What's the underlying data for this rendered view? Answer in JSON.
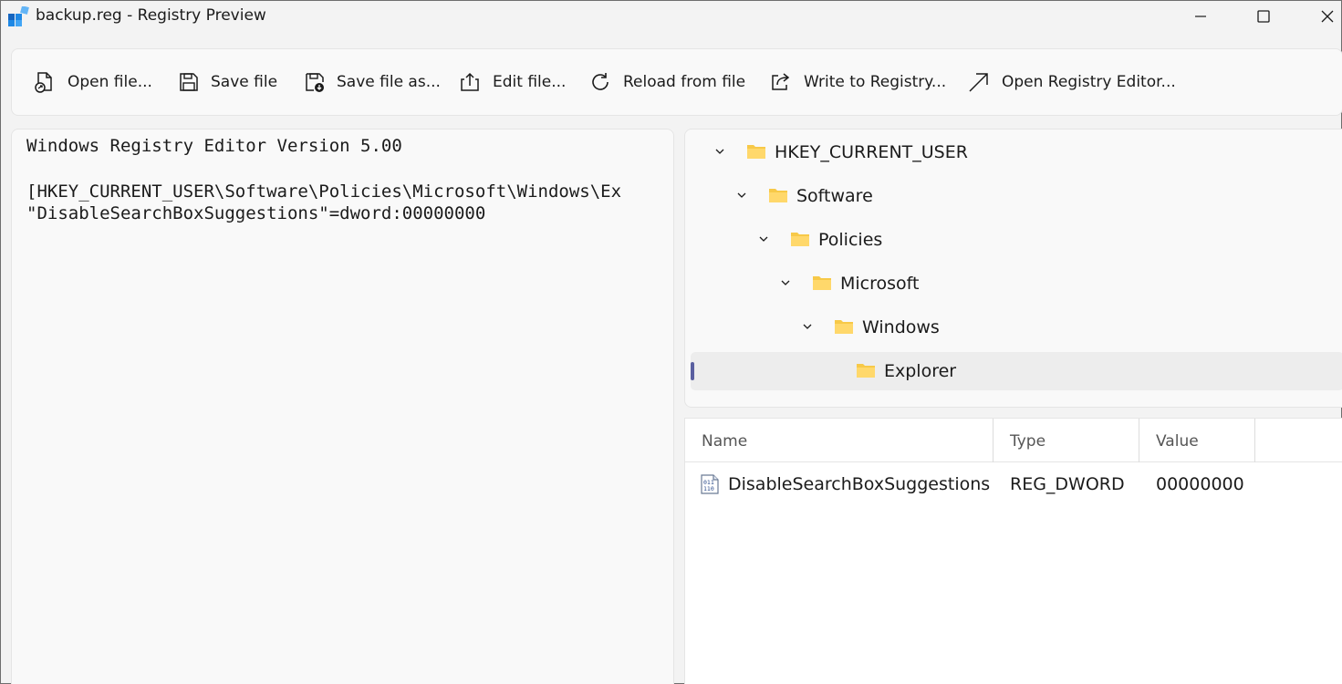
{
  "window": {
    "title": "backup.reg - Registry Preview",
    "icon": "registry-preview-app-icon",
    "controls": [
      "minimize-icon",
      "maximize-icon",
      "close-icon"
    ]
  },
  "toolbar": {
    "open_file": "Open file...",
    "save_file": "Save file",
    "save_file_as": "Save file as...",
    "edit_file": "Edit file...",
    "reload_from_file": "Reload from file",
    "write_to_registry": "Write to Registry...",
    "open_registry_editor": "Open Registry Editor..."
  },
  "editor": {
    "lines": [
      "Windows Registry Editor Version 5.00",
      "",
      "[HKEY_CURRENT_USER\\Software\\Policies\\Microsoft\\Windows\\Ex",
      "\"DisableSearchBoxSuggestions\"=dword:00000000"
    ]
  },
  "tree": {
    "items": [
      {
        "label": "HKEY_CURRENT_USER",
        "expanded": true
      },
      {
        "label": "Software",
        "expanded": true
      },
      {
        "label": "Policies",
        "expanded": true
      },
      {
        "label": "Microsoft",
        "expanded": true
      },
      {
        "label": "Windows",
        "expanded": true
      },
      {
        "label": "Explorer",
        "selected": true
      }
    ]
  },
  "values_table": {
    "columns": [
      "Name",
      "Type",
      "Value"
    ],
    "rows": [
      {
        "name": "DisableSearchBoxSuggestions",
        "type": "REG_DWORD",
        "value": "00000000",
        "icon": "binary-value-icon"
      }
    ]
  },
  "colors": {
    "folder": "#f7c948",
    "accent": "#5a5fa0",
    "app_icon": "#1e88e5"
  }
}
